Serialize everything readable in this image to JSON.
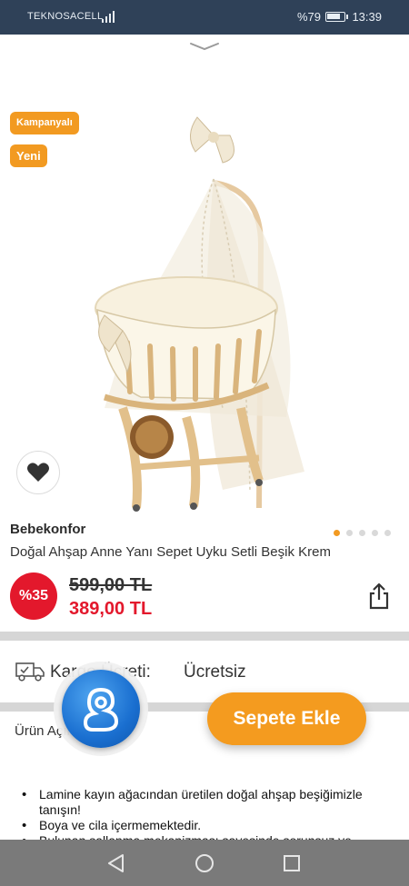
{
  "status_bar": {
    "carrier": "TEKNOSACELL",
    "network_type": "4G",
    "battery_percent": "%79",
    "time": "13:39"
  },
  "badges": {
    "campaign": "Kampanyalı",
    "new": "Yeni"
  },
  "product": {
    "brand": "Bebekonfor",
    "title": "Doğal Ahşap Anne Yanı Sepet Uyku Setli Beşik Krem",
    "discount": "%35",
    "old_price": "599,00 TL",
    "new_price": "389,00 TL",
    "image_count": 5,
    "active_image_index": 0
  },
  "cargo": {
    "label": "Kargo Ücreti:",
    "value": "Ücretsiz"
  },
  "description": {
    "label": "Ürün Açıklaması",
    "items": [
      "Lamine kayın ağacından üretilen doğal ahşap beşiğimizle tanışın!",
      "Boya ve cila içermemektedir.",
      "Bulunan sallanma mekanizması sayesinde sorunsuz ve"
    ]
  },
  "actions": {
    "add_to_cart": "Sepete Ekle"
  },
  "colors": {
    "accent_orange": "#f49b1f",
    "discount_red": "#e3182c",
    "status_bar": "#2f4158",
    "nav_bar": "#7a7a7a"
  },
  "icons": {
    "favorite": "heart-icon",
    "share": "share-icon",
    "cargo": "truck-icon",
    "chat": "chat-assistant-icon",
    "nav_back": "back-triangle-icon",
    "nav_home": "home-circle-icon",
    "nav_recent": "recent-square-icon"
  }
}
